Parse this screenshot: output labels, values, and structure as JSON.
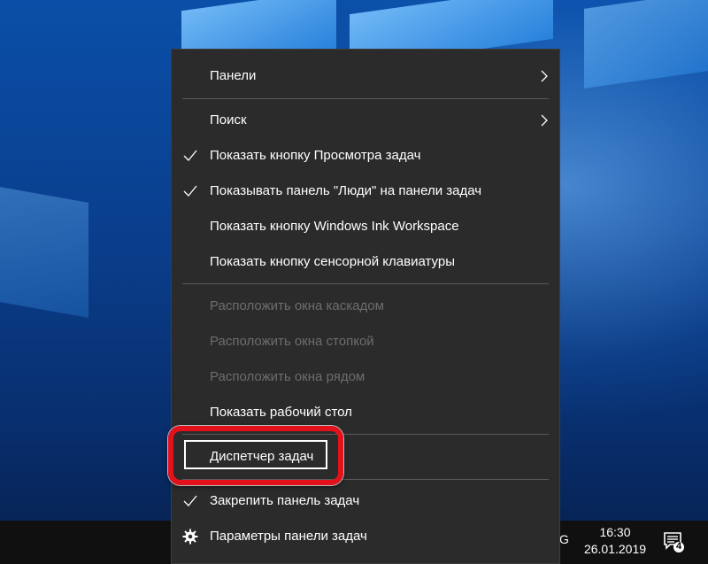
{
  "menu": {
    "items": [
      {
        "label": "Панели",
        "submenu": true
      },
      {
        "label": "Поиск",
        "submenu": true
      },
      {
        "label": "Показать кнопку Просмотра задач",
        "checked": true
      },
      {
        "label": "Показывать панель \"Люди\" на панели задач",
        "checked": true
      },
      {
        "label": "Показать кнопку Windows Ink Workspace"
      },
      {
        "label": "Показать кнопку сенсорной клавиатуры"
      },
      {
        "label": "Расположить окна каскадом",
        "disabled": true
      },
      {
        "label": "Расположить окна стопкой",
        "disabled": true
      },
      {
        "label": "Расположить окна рядом",
        "disabled": true
      },
      {
        "label": "Показать рабочий стол"
      },
      {
        "label": "Диспетчер задач",
        "highlighted": true
      },
      {
        "label": "Закрепить панель задач",
        "checked": true
      },
      {
        "label": "Параметры панели задач",
        "icon": "gear-icon"
      }
    ]
  },
  "taskbar": {
    "language": "G",
    "time": "16:30",
    "date": "26.01.2019",
    "notification_count": "4"
  },
  "colors": {
    "menu_bg": "#2b2b2b",
    "highlight_border": "#e3111c",
    "disabled_text": "#6d6d6d",
    "taskbar_bg": "#101010"
  }
}
